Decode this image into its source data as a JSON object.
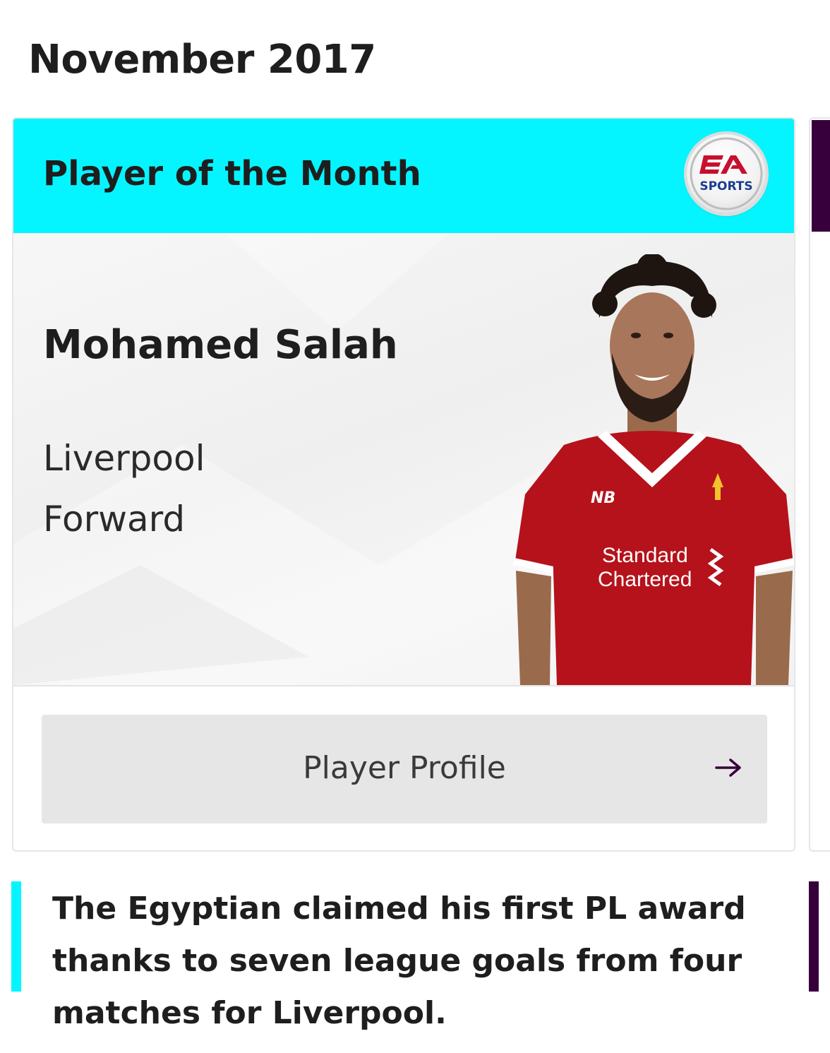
{
  "month_heading": "November 2017",
  "award": {
    "title": "Player of the Month",
    "sponsor_logo": {
      "icon": "ea-sports-logo-icon",
      "text_top": "EA",
      "text_bottom": "SPORTS"
    }
  },
  "player": {
    "name": "Mohamed Salah",
    "club": "Liverpool",
    "position": "Forward",
    "photo_icon": "player-photo-icon",
    "shirt_sponsor": [
      "Standard",
      "Chartered"
    ]
  },
  "actions": {
    "profile_label": "Player Profile",
    "arrow_icon": "arrow-right-icon"
  },
  "description": "The Egyptian claimed his first PL award thanks to seven league goals from four matches for Liverpool.",
  "colors": {
    "header_accent": "#04f5ff",
    "next_card_accent": "#37003c",
    "shirt_red": "#b5121b"
  }
}
